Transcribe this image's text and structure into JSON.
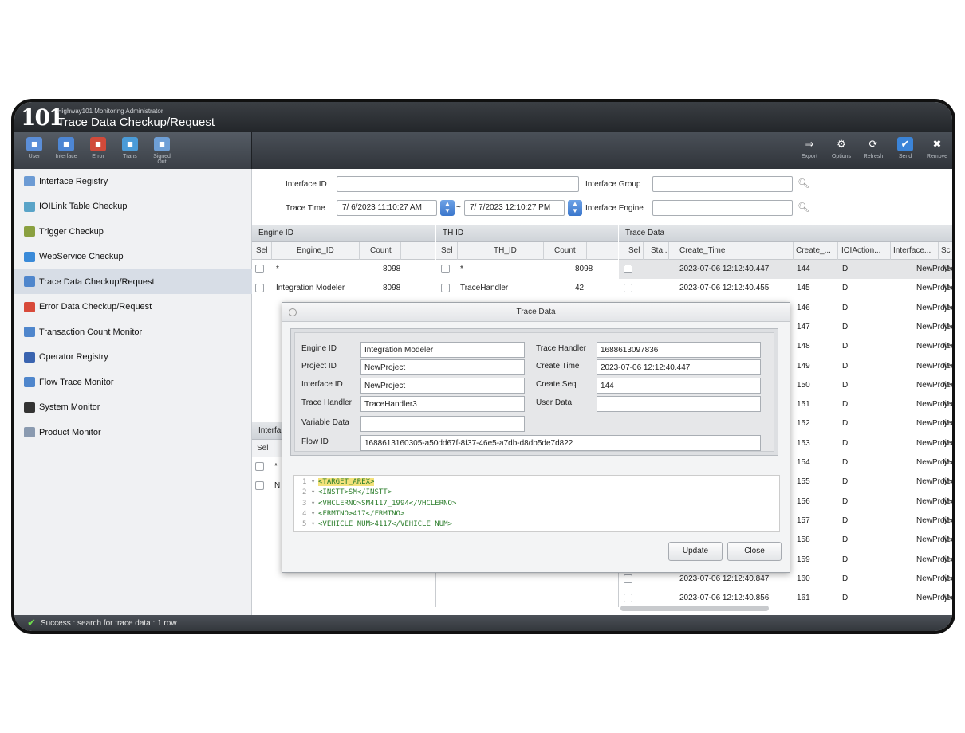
{
  "app": {
    "subtitle": "Highway101 Monitoring Administrator",
    "title": "Trace Data Checkup/Request",
    "logo": "101"
  },
  "toolbar_left": [
    {
      "label": "User",
      "icon": "user-gear-icon"
    },
    {
      "label": "Interface",
      "icon": "interface-icon"
    },
    {
      "label": "Error",
      "icon": "error-icon"
    },
    {
      "label": "Trans",
      "icon": "trans-icon"
    },
    {
      "label": "Signed Out",
      "icon": "signout-icon"
    }
  ],
  "toolbar_right": [
    {
      "label": "Export",
      "icon": "export-icon"
    },
    {
      "label": "Options",
      "icon": "options-icon"
    },
    {
      "label": "Refresh",
      "icon": "refresh-icon"
    },
    {
      "label": "Send",
      "icon": "send-icon"
    },
    {
      "label": "Remove",
      "icon": "remove-icon"
    }
  ],
  "sidebar": [
    {
      "label": "Interface Registry"
    },
    {
      "label": "IOILink Table Checkup"
    },
    {
      "label": "Trigger Checkup"
    },
    {
      "label": "WebService Checkup"
    },
    {
      "label": "Trace Data Checkup/Request",
      "active": true
    },
    {
      "label": "Error Data Checkup/Request"
    },
    {
      "label": "Transaction Count Monitor"
    },
    {
      "label": "Operator Registry"
    },
    {
      "label": "Flow Trace Monitor"
    },
    {
      "label": "System Monitor"
    },
    {
      "label": "Product Monitor"
    }
  ],
  "search": {
    "interface_id_label": "Interface ID",
    "interface_id_value": "",
    "interface_group_label": "Interface Group",
    "interface_group_value": "",
    "trace_time_label": "Trace Time",
    "from": "7/ 6/2023  11:10:27 AM",
    "to": "7/ 7/2023  12:10:27 PM",
    "tilde": "~",
    "interface_engine_label": "Interface Engine",
    "interface_engine_value": ""
  },
  "engine_panel": {
    "title": "Engine ID",
    "columns": [
      "Sel",
      "Engine_ID",
      "Count"
    ],
    "rows": [
      {
        "id": "*",
        "count": "8098"
      },
      {
        "id": "Integration Modeler",
        "count": "8098"
      }
    ]
  },
  "th_panel": {
    "title": "TH ID",
    "columns": [
      "Sel",
      "TH_ID",
      "Count"
    ],
    "rows": [
      {
        "id": "*",
        "count": "8098"
      },
      {
        "id": "TraceHandler",
        "count": "42"
      }
    ]
  },
  "interface_panel": {
    "title": "Interfa",
    "sel": "Sel",
    "rows": [
      "*",
      "N"
    ]
  },
  "trace_panel": {
    "title": "Trace Data",
    "columns": [
      "Sel",
      "Sta...",
      "Create_Time",
      "Create_...",
      "IOIAction...",
      "Interface...",
      "Sc"
    ],
    "rows": [
      {
        "time": "2023-07-06 12:12:40.447",
        "seq": "144",
        "action": "D",
        "project": "NewProject",
        "s": "M"
      },
      {
        "time": "2023-07-06 12:12:40.455",
        "seq": "145",
        "action": "D",
        "project": "NewProject",
        "s": "M"
      },
      {
        "time": "",
        "seq": "146",
        "action": "D",
        "project": "NewProject",
        "s": "M"
      },
      {
        "time": "",
        "seq": "147",
        "action": "D",
        "project": "NewProject",
        "s": "M"
      },
      {
        "time": "",
        "seq": "148",
        "action": "D",
        "project": "NewProject",
        "s": "M"
      },
      {
        "time": "",
        "seq": "149",
        "action": "D",
        "project": "NewProject",
        "s": "M"
      },
      {
        "time": "",
        "seq": "150",
        "action": "D",
        "project": "NewProject",
        "s": "M"
      },
      {
        "time": "",
        "seq": "151",
        "action": "D",
        "project": "NewProject",
        "s": "M"
      },
      {
        "time": "",
        "seq": "152",
        "action": "D",
        "project": "NewProject",
        "s": "M"
      },
      {
        "time": "",
        "seq": "153",
        "action": "D",
        "project": "NewProject",
        "s": "M"
      },
      {
        "time": "",
        "seq": "154",
        "action": "D",
        "project": "NewProject",
        "s": "M"
      },
      {
        "time": "",
        "seq": "155",
        "action": "D",
        "project": "NewProject",
        "s": "M"
      },
      {
        "time": "",
        "seq": "156",
        "action": "D",
        "project": "NewProject",
        "s": "M"
      },
      {
        "time": "",
        "seq": "157",
        "action": "D",
        "project": "NewProject",
        "s": "M"
      },
      {
        "time": "",
        "seq": "158",
        "action": "D",
        "project": "NewProject",
        "s": "M"
      },
      {
        "time": "",
        "seq": "159",
        "action": "D",
        "project": "NewProject",
        "s": "M"
      },
      {
        "time": "2023-07-06 12:12:40.847",
        "seq": "160",
        "action": "D",
        "project": "NewProject",
        "s": "M"
      },
      {
        "time": "2023-07-06 12:12:40.856",
        "seq": "161",
        "action": "D",
        "project": "NewProject",
        "s": "M"
      }
    ]
  },
  "dialog": {
    "title": "Trace Data",
    "engine_id_label": "Engine ID",
    "engine_id": "Integration Modeler",
    "project_id_label": "Project ID",
    "project_id": "NewProject",
    "interface_id_label": "Interface ID",
    "interface_id": "NewProject",
    "trace_handler_label": "Trace Handler",
    "trace_handler": "TraceHandler3",
    "variable_data_label": "Variable Data",
    "variable_data": "",
    "flow_id_label": "Flow ID",
    "flow_id": "1688613160305-a50dd67f-8f37-46e5-a7db-d8db5de7d822",
    "trace_handler2_label": "Trace Handler",
    "trace_handler2": "1688613097836",
    "create_time_label": "Create Time",
    "create_time": "2023-07-06 12:12:40.447",
    "create_seq_label": "Create Seq",
    "create_seq": "144",
    "user_data_label": "User Data",
    "user_data": "",
    "code": [
      {
        "no": "1 ▾",
        "text": "<TARGET_AREX>"
      },
      {
        "no": "2 ▾",
        "text": "    <INSTT>SM</INSTT>"
      },
      {
        "no": "3 ▾",
        "text": "    <VHCLERNO>SM4117_1994</VHCLERNO>"
      },
      {
        "no": "4 ▾",
        "text": "    <FRMTNO>417</FRMTNO>"
      },
      {
        "no": "5 ▾",
        "text": "    <VEHICLE_NUM>4117</VEHICLE_NUM>"
      }
    ],
    "update_label": "Update",
    "close_label": "Close"
  },
  "status": {
    "text": "Success : search for trace data : 1 row"
  }
}
